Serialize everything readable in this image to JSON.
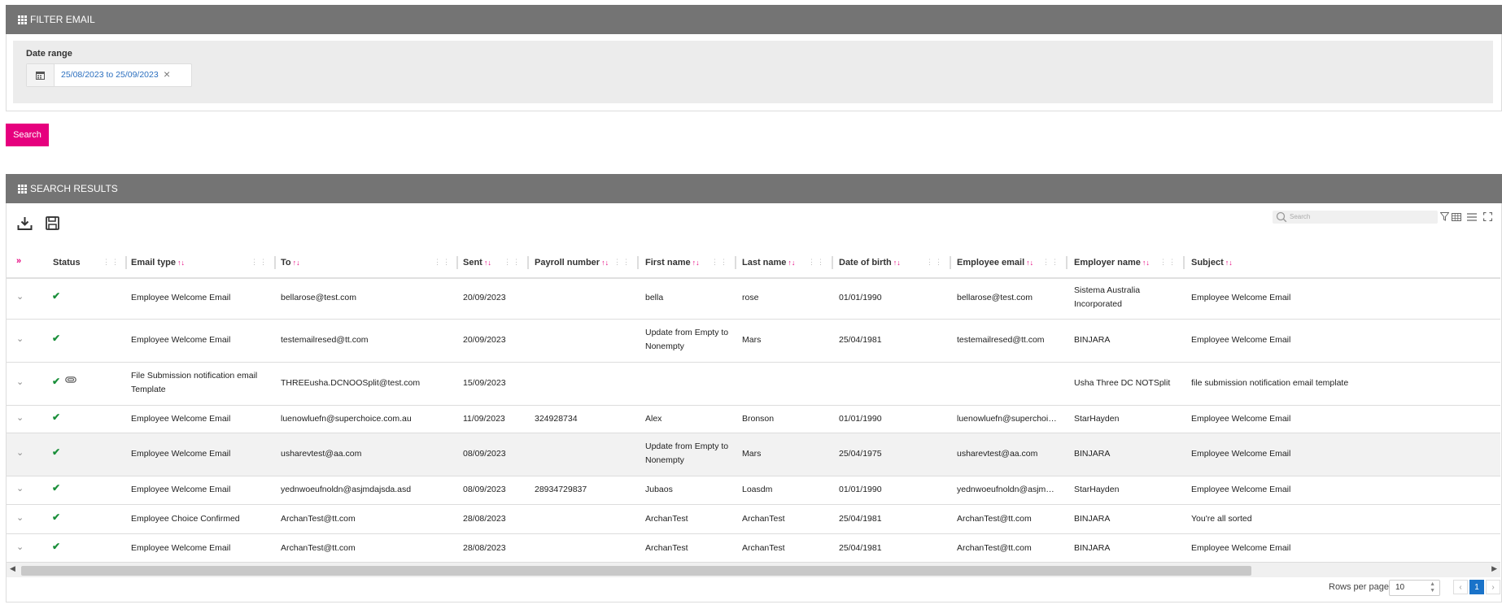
{
  "filter_panel": {
    "title": "FILTER EMAIL",
    "date_label": "Date range",
    "date_value": "25/08/2023 to 25/09/2023"
  },
  "search_button": "Search",
  "results_panel": {
    "title": "SEARCH RESULTS",
    "search_placeholder": "Search"
  },
  "columns": [
    "Status",
    "Email type",
    "To",
    "Sent",
    "Payroll number",
    "First name",
    "Last name",
    "Date of birth",
    "Employee email",
    "Employer name",
    "Subject"
  ],
  "rows": [
    {
      "clip": false,
      "email_type": "Employee Welcome Email",
      "to": "bellarose@test.com",
      "sent": "20/09/2023",
      "payroll": "",
      "first": "bella",
      "last": "rose",
      "dob": "01/01/1990",
      "emp_email": "bellarose@test.com",
      "employer": "Sistema Australia Incorporated",
      "subject": "Employee Welcome Email"
    },
    {
      "clip": false,
      "email_type": "Employee Welcome Email",
      "to": "testemailresed@tt.com",
      "sent": "20/09/2023",
      "payroll": "",
      "first": "Update from Empty to Nonempty",
      "last": "Mars",
      "dob": "25/04/1981",
      "emp_email": "testemailresed@tt.com",
      "employer": "BINJARA",
      "subject": "Employee Welcome Email"
    },
    {
      "clip": true,
      "email_type": "File Submission notification email Template",
      "to": "THREEusha.DCNOOSplit@test.com",
      "sent": "15/09/2023",
      "payroll": "",
      "first": "",
      "last": "",
      "dob": "",
      "emp_email": "",
      "employer": "Usha Three DC NOTSplit",
      "subject": "file submission notification email template"
    },
    {
      "clip": false,
      "email_type": "Employee Welcome Email",
      "to": "luenowluefn@superchoice.com.au",
      "sent": "11/09/2023",
      "payroll": "324928734",
      "first": "Alex",
      "last": "Bronson",
      "dob": "01/01/1990",
      "emp_email": "luenowluefn@superchoi…",
      "employer": "StarHayden",
      "subject": "Employee Welcome Email"
    },
    {
      "clip": false,
      "email_type": "Employee Welcome Email",
      "to": "usharevtest@aa.com",
      "sent": "08/09/2023",
      "payroll": "",
      "first": "Update from Empty to Nonempty",
      "last": "Mars",
      "dob": "25/04/1975",
      "emp_email": "usharevtest@aa.com",
      "employer": "BINJARA",
      "subject": "Employee Welcome Email"
    },
    {
      "clip": false,
      "email_type": "Employee Welcome Email",
      "to": "yednwoeufnoldn@asjmdajsda.asd",
      "sent": "08/09/2023",
      "payroll": "28934729837",
      "first": "Jubaos",
      "last": "Loasdm",
      "dob": "01/01/1990",
      "emp_email": "yednwoeufnoldn@asjm…",
      "employer": "StarHayden",
      "subject": "Employee Welcome Email"
    },
    {
      "clip": false,
      "email_type": "Employee Choice Confirmed",
      "to": "ArchanTest@tt.com",
      "sent": "28/08/2023",
      "payroll": "",
      "first": "ArchanTest",
      "last": "ArchanTest",
      "dob": "25/04/1981",
      "emp_email": "ArchanTest@tt.com",
      "employer": "BINJARA",
      "subject": "You're all sorted"
    },
    {
      "clip": false,
      "email_type": "Employee Welcome Email",
      "to": "ArchanTest@tt.com",
      "sent": "28/08/2023",
      "payroll": "",
      "first": "ArchanTest",
      "last": "ArchanTest",
      "dob": "25/04/1981",
      "emp_email": "ArchanTest@tt.com",
      "employer": "BINJARA",
      "subject": "Employee Welcome Email"
    }
  ],
  "pagination": {
    "rows_per_page_label": "Rows per page",
    "rows_per_page": "10",
    "current_page": "1"
  }
}
